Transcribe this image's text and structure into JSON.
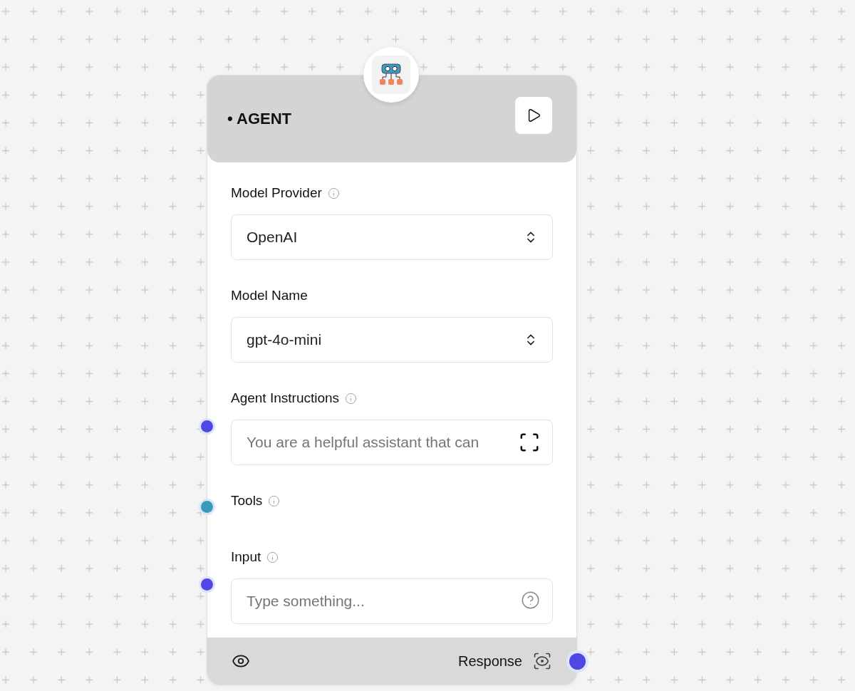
{
  "node": {
    "title": "• AGENT",
    "fields": [
      {
        "kind": "select",
        "label": "Model Provider",
        "info": true,
        "value": "OpenAI"
      },
      {
        "kind": "select",
        "label": "Model Name",
        "info": false,
        "value": "gpt-4o-mini"
      },
      {
        "kind": "prompt",
        "label": "Agent Instructions",
        "info": true,
        "placeholder": "You are a helpful assistant that can",
        "handle": {
          "color": "#4f46e5"
        }
      },
      {
        "kind": "label",
        "label": "Tools",
        "info": true,
        "handle": {
          "color": "#3a9bb8"
        }
      },
      {
        "kind": "text",
        "label": "Input",
        "info": true,
        "placeholder": "Type something...",
        "handle": {
          "color": "#4f46e5"
        }
      }
    ],
    "footer": {
      "output_label": "Response",
      "handle": {
        "color": "#4f46e5"
      }
    }
  }
}
